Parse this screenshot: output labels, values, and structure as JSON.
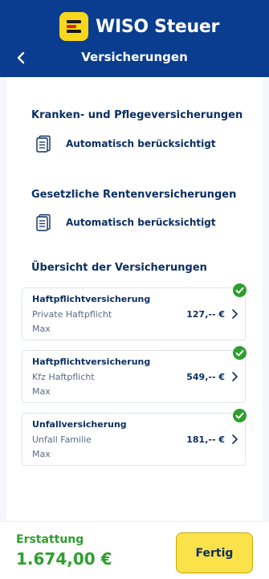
{
  "header": {
    "logo_text": "WISO Steuer",
    "page_title": "Versicherungen"
  },
  "sections": [
    {
      "title": "Kranken- und Pflegeversicherungen",
      "status": "Automatisch berücksichtigt"
    },
    {
      "title": "Gesetzliche Rentenversicherungen",
      "status": "Automatisch berücksichtigt"
    }
  ],
  "overview": {
    "title": "Übersicht der Versicherungen",
    "cards": [
      {
        "title": "Haftpflichtversicherung",
        "subtitle": "Private Haftpflicht",
        "person": "Max",
        "amount": "127,-- €"
      },
      {
        "title": "Haftpflichtversicherung",
        "subtitle": "Kfz Haftpflicht",
        "person": "Max",
        "amount": "549,-- €"
      },
      {
        "title": "Unfallversicherung",
        "subtitle": "Unfall Familie",
        "person": "Max",
        "amount": "181,-- €"
      }
    ]
  },
  "footer": {
    "refund_label": "Erstattung",
    "refund_value": "1.674,00 €",
    "done_label": "Fertig"
  },
  "colors": {
    "header_bg": "#0a3d8f",
    "accent_yellow": "#fbe14a",
    "success_green": "#2e9e2e",
    "text_navy": "#0b2f63"
  },
  "icons": [
    "back-chevron-icon",
    "document-icon",
    "chevron-right-icon",
    "check-circle-icon"
  ]
}
